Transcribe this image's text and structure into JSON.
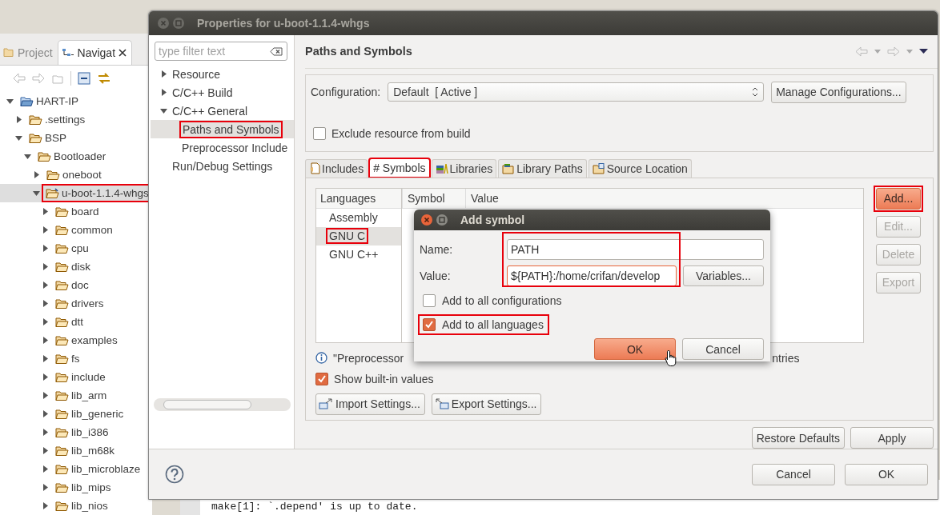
{
  "navigator": {
    "tabs": [
      {
        "label": "Project",
        "selected": false
      },
      {
        "label": "Navigat",
        "selected": true
      }
    ],
    "tree": [
      {
        "label": "HART-IP",
        "kind": "project",
        "expanded": true,
        "selected": false,
        "highlighted": false,
        "children": [
          {
            "label": ".settings",
            "kind": "folder",
            "expanded": false,
            "selected": false,
            "highlighted": false
          },
          {
            "label": "BSP",
            "kind": "folder",
            "expanded": true,
            "selected": false,
            "highlighted": false,
            "children": [
              {
                "label": "Bootloader",
                "kind": "folder",
                "expanded": true,
                "selected": false,
                "highlighted": false,
                "children": [
                  {
                    "label": "oneboot",
                    "kind": "folder",
                    "expanded": false,
                    "selected": false,
                    "highlighted": false
                  },
                  {
                    "label": "u-boot-1.1.4-whgs",
                    "kind": "linked-folder",
                    "expanded": true,
                    "selected": true,
                    "highlighted": true,
                    "children": [
                      {
                        "label": "board",
                        "kind": "folder",
                        "expanded": false,
                        "selected": false,
                        "highlighted": false
                      },
                      {
                        "label": "common",
                        "kind": "folder",
                        "expanded": false,
                        "selected": false,
                        "highlighted": false
                      },
                      {
                        "label": "cpu",
                        "kind": "folder",
                        "expanded": false,
                        "selected": false,
                        "highlighted": false
                      },
                      {
                        "label": "disk",
                        "kind": "folder",
                        "expanded": false,
                        "selected": false,
                        "highlighted": false
                      },
                      {
                        "label": "doc",
                        "kind": "folder",
                        "expanded": false,
                        "selected": false,
                        "highlighted": false
                      },
                      {
                        "label": "drivers",
                        "kind": "folder",
                        "expanded": false,
                        "selected": false,
                        "highlighted": false
                      },
                      {
                        "label": "dtt",
                        "kind": "folder",
                        "expanded": false,
                        "selected": false,
                        "highlighted": false
                      },
                      {
                        "label": "examples",
                        "kind": "folder",
                        "expanded": false,
                        "selected": false,
                        "highlighted": false
                      },
                      {
                        "label": "fs",
                        "kind": "folder",
                        "expanded": false,
                        "selected": false,
                        "highlighted": false
                      },
                      {
                        "label": "include",
                        "kind": "folder",
                        "expanded": false,
                        "selected": false,
                        "highlighted": false
                      },
                      {
                        "label": "lib_arm",
                        "kind": "folder",
                        "expanded": false,
                        "selected": false,
                        "highlighted": false
                      },
                      {
                        "label": "lib_generic",
                        "kind": "folder",
                        "expanded": false,
                        "selected": false,
                        "highlighted": false
                      },
                      {
                        "label": "lib_i386",
                        "kind": "folder",
                        "expanded": false,
                        "selected": false,
                        "highlighted": false
                      },
                      {
                        "label": "lib_m68k",
                        "kind": "folder",
                        "expanded": false,
                        "selected": false,
                        "highlighted": false
                      },
                      {
                        "label": "lib_microblaze",
                        "kind": "folder",
                        "expanded": false,
                        "selected": false,
                        "highlighted": false
                      },
                      {
                        "label": "lib_mips",
                        "kind": "folder",
                        "expanded": false,
                        "selected": false,
                        "highlighted": false
                      },
                      {
                        "label": "lib_nios",
                        "kind": "folder",
                        "expanded": false,
                        "selected": false,
                        "highlighted": false
                      }
                    ]
                  }
                ]
              }
            ]
          }
        ]
      }
    ]
  },
  "dialog": {
    "title": "Properties for u-boot-1.1.4-whgs",
    "filter": {
      "placeholder": "type filter text"
    },
    "tree": [
      {
        "label": "Resource",
        "kind": "branch",
        "expanded": false,
        "selected": false,
        "highlighted": false
      },
      {
        "label": "C/C++ Build",
        "kind": "branch",
        "expanded": false,
        "selected": false,
        "highlighted": false
      },
      {
        "label": "C/C++ General",
        "kind": "branch",
        "expanded": true,
        "selected": false,
        "highlighted": false,
        "children": [
          {
            "label": "Paths and Symbols",
            "kind": "leaf",
            "selected": true,
            "highlighted": true
          },
          {
            "label": "Preprocessor Include",
            "kind": "leaf",
            "selected": false,
            "highlighted": false
          }
        ]
      },
      {
        "label": "Run/Debug Settings",
        "kind": "leaf",
        "selected": false,
        "highlighted": false
      }
    ],
    "page_title": "Paths and Symbols",
    "configuration": {
      "label": "Configuration:",
      "value": "Default  [ Active ]",
      "manage_button": "Manage Configurations..."
    },
    "exclude": {
      "label": "Exclude resource from build",
      "checked": false
    },
    "tabs": [
      {
        "label": "Includes",
        "kind": "includes",
        "selected": false,
        "highlighted": false
      },
      {
        "label": "# Symbols",
        "kind": "symbols",
        "selected": true,
        "highlighted": true
      },
      {
        "label": "Libraries",
        "kind": "libraries",
        "selected": false,
        "highlighted": false
      },
      {
        "label": "Library Paths",
        "kind": "library-paths",
        "selected": false,
        "highlighted": false
      },
      {
        "label": "Source Location",
        "kind": "source-location",
        "selected": false,
        "highlighted": false
      }
    ],
    "languages": {
      "header": "Languages",
      "items": [
        {
          "label": "Assembly",
          "selected": false,
          "highlighted": false
        },
        {
          "label": "GNU C",
          "selected": true,
          "highlighted": true
        },
        {
          "label": "GNU C++",
          "selected": false,
          "highlighted": false
        }
      ]
    },
    "symbol_columns": [
      "Symbol",
      "Value"
    ],
    "side_buttons": [
      {
        "label": "Add...",
        "disabled": false,
        "default": true,
        "highlighted": true
      },
      {
        "label": "Edit...",
        "disabled": true,
        "default": false,
        "highlighted": false
      },
      {
        "label": "Delete",
        "disabled": true,
        "default": false,
        "highlighted": false
      },
      {
        "label": "Export",
        "disabled": true,
        "default": false,
        "highlighted": false
      }
    ],
    "info_note": {
      "visible_start": "\"Preprocessor",
      "visible_end": "ntries"
    },
    "show_builtin": {
      "label": "Show built-in values",
      "checked": true
    },
    "import_button": "Import Settings...",
    "export_button": "Export Settings...",
    "restore_button": "Restore Defaults",
    "apply_button": "Apply",
    "buttons": [
      "Cancel",
      "OK"
    ]
  },
  "add_symbol": {
    "title": "Add symbol",
    "name_label": "Name:",
    "name_value": "PATH",
    "value_label": "Value:",
    "value_value": "${PATH}:/home/crifan/develop",
    "fields_highlighted": true,
    "variables_button": "Variables...",
    "options": [
      {
        "label": "Add to all configurations",
        "checked": false,
        "highlighted": false
      },
      {
        "label": "Add to all languages",
        "checked": true,
        "highlighted": true
      }
    ],
    "buttons": [
      {
        "label": "OK",
        "default": true
      },
      {
        "label": "Cancel",
        "default": false
      }
    ]
  },
  "console": {
    "line": "make[1]: `.depend' is up to date."
  }
}
